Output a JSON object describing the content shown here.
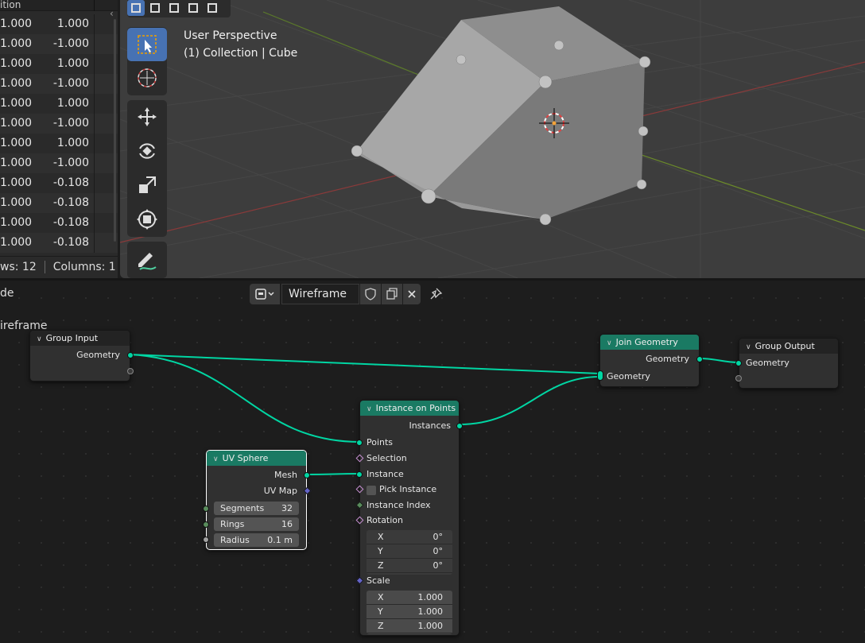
{
  "spreadsheet": {
    "header_label": "ition",
    "rows": [
      {
        "a": "1.000",
        "b": "1.000"
      },
      {
        "a": "1.000",
        "b": "-1.000"
      },
      {
        "a": "1.000",
        "b": "1.000"
      },
      {
        "a": "1.000",
        "b": "-1.000"
      },
      {
        "a": "1.000",
        "b": "1.000"
      },
      {
        "a": "1.000",
        "b": "-1.000"
      },
      {
        "a": "1.000",
        "b": "1.000"
      },
      {
        "a": "1.000",
        "b": "-1.000"
      },
      {
        "a": "1.000",
        "b": "-0.108"
      },
      {
        "a": "1.000",
        "b": "-0.108"
      },
      {
        "a": "1.000",
        "b": "-0.108"
      },
      {
        "a": "1.000",
        "b": "-0.108"
      }
    ],
    "footer_rows": "ws: 12",
    "footer_cols": "Columns: 1"
  },
  "viewport": {
    "line1": "User Perspective",
    "line2": "(1) Collection | Cube"
  },
  "node_editor": {
    "title": "de",
    "tree_label": "ireframe",
    "tree_name": "Wireframe"
  },
  "nodes": {
    "group_input": {
      "title": "Group Input",
      "out_geometry": "Geometry"
    },
    "join": {
      "title": "Join Geometry",
      "out_geometry": "Geometry",
      "in_geometry": "Geometry"
    },
    "group_output": {
      "title": "Group Output",
      "in_geometry": "Geometry"
    },
    "iop": {
      "title": "Instance on Points",
      "out_instances": "Instances",
      "points": "Points",
      "selection": "Selection",
      "instance": "Instance",
      "pick": "Pick Instance",
      "index": "Instance Index",
      "rotation": "Rotation",
      "rot": [
        {
          "k": "X",
          "v": "0°"
        },
        {
          "k": "Y",
          "v": "0°"
        },
        {
          "k": "Z",
          "v": "0°"
        }
      ],
      "scale": "Scale",
      "scl": [
        {
          "k": "X",
          "v": "1.000"
        },
        {
          "k": "Y",
          "v": "1.000"
        },
        {
          "k": "Z",
          "v": "1.000"
        }
      ]
    },
    "uv": {
      "title": "UV Sphere",
      "mesh": "Mesh",
      "uvmap": "UV Map",
      "segments_k": "Segments",
      "segments_v": "32",
      "rings_k": "Rings",
      "rings_v": "16",
      "radius_k": "Radius",
      "radius_v": "0.1 m"
    }
  },
  "colors": {
    "geometry_socket": "#00d6a3",
    "geometry_header": "#1a7a63",
    "active_blue": "#4772b3"
  }
}
